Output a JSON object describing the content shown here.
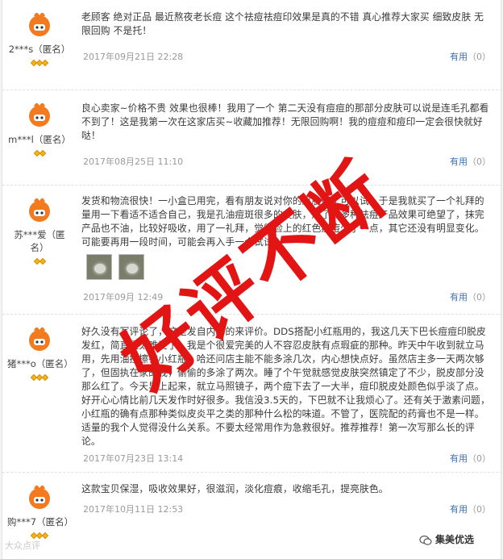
{
  "reviews": [
    {
      "user": "2***s（匿名）",
      "stars": 3,
      "text": "老顾客 绝对正品 最近熬夜老长痘 这个祛痘祛痘印效果是真的不错 真心推荐大家买 细致皮肤 无限回购 不是托！",
      "date": "2017年09月21日 22:28",
      "helpful_label": "有用",
      "helpful_count": "（0）"
    },
    {
      "user": "m***l（匿名）",
      "stars": 2,
      "text": "良心卖家~价格不贵 效果也很棒！我用了一个 第二天没有痘痘的那部分皮肤可以说是连毛孔都看不到了！这是我第一次在这家店买~收藏加推荐！无限回购啊！我的痘痘和痘印一定会很快就好哒！",
      "date": "2017年08月25日 11:10",
      "helpful_label": "有用",
      "helpful_count": "（0）"
    },
    {
      "user": "苏***爱（匿名）",
      "stars": 2,
      "text": "发货和物流很快！一小盒已用完，看有朋友说对你的肌肤好了可以试，于是我就买了一个礼拜的量用一下看适不适合自己，我是孔油痘斑很多的皮肤，用了很多种祛痘产品效果可绝望了，抹完产品也不油，比较好吸收，用了一礼拜，觉得脸上的红色痘痘少了一点，其它还没有明显变化。可能要再用一段时间，可能会再入手一个试试。",
      "date": "2017年09月  12:49",
      "helpful_label": "有用",
      "helpful_count": "（0）"
    },
    {
      "user": "猪***o（匿名）",
      "stars": 3,
      "text": "好久没有写评论了，这是发自内心的来评价。DDS搭配小红瓶用的，我这几天下巴长痘痘印脱皮发红，简直是太难受了，我是个很爱完美的人不容忍皮肤有点瑕疵的那种。昨天中午收到就立马用，先用油控擦在小红瓶。哈还问店主能不能多涂几次，内心想快点好。虽然店主多一天两次够了，但固执在家的我，偷偷的多涂了两次。睡了个午觉就感觉皮肤突然镇定了不少，脱皮部分没那么红了。今天早上起来，就立马照镜子，两个痘下去了一大半，痘印脱皮处颜色似乎淡了点。好开心心情比前几天发作时好很多。我信没3.5天的，下巴就不让我烦心了。还有关于激素问题，小红瓶的确有点那种类似皮炎平之类的那种什么松的味道。不管了，医院配的药膏也不是一样。适量的我个人觉得没什么关系。不要太经常用作为急救很好。推荐推荐！第一次写那么长的评论。",
      "date": "2017年07月23日 13:14",
      "helpful_label": "有用",
      "helpful_count": "（0）"
    },
    {
      "user": "购***7（匿名）",
      "stars": 3,
      "text": "这款宝贝保湿，吸收效果好，很滋润，淡化痘痕，收缩毛孔，提亮肤色。",
      "date": "2017年10月11日 12:53",
      "helpful_label": "有用",
      "helpful_count": "（0）"
    }
  ],
  "stamp": {
    "text": "好评不断",
    "color": "#e31414"
  },
  "watermark_left": "大众点评",
  "watermark_right": "集美优选",
  "colors": {
    "link": "#3b6fb6",
    "meta": "#9a9a9a",
    "avatar": "#f47a1f"
  }
}
